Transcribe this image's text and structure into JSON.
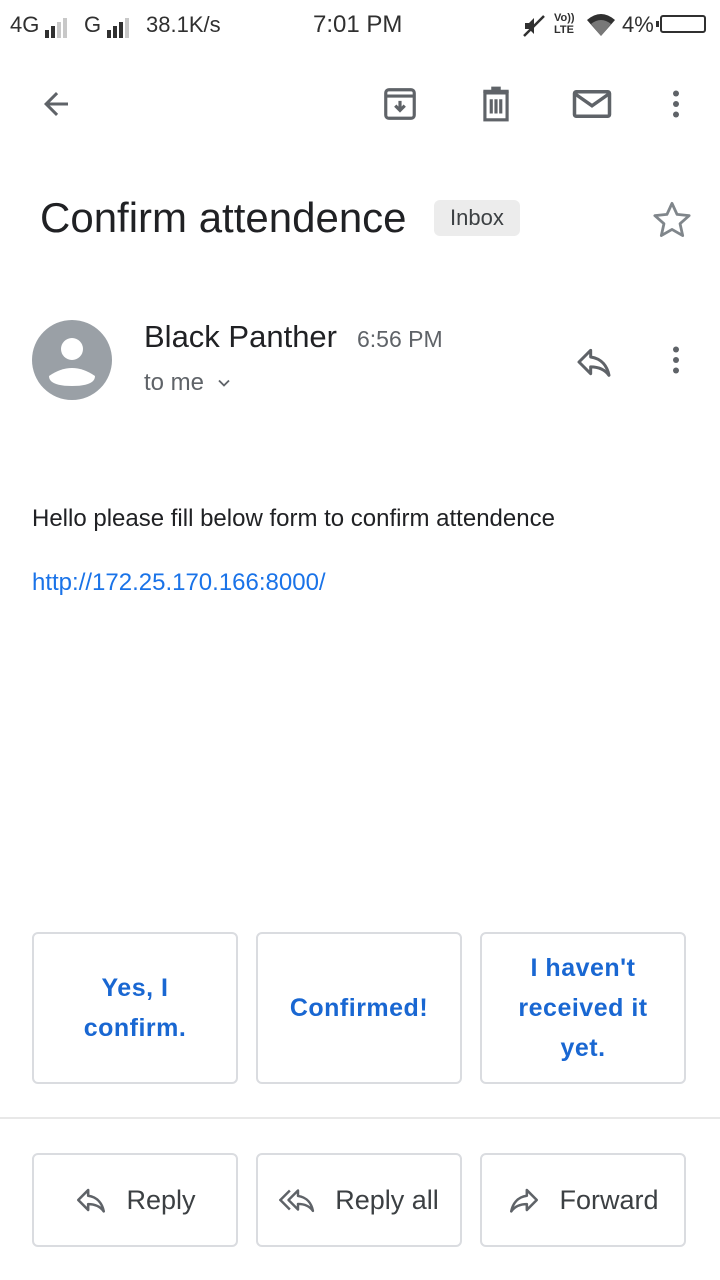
{
  "status_bar": {
    "network1": "4G",
    "network2": "G",
    "speed": "38.1K/s",
    "time": "7:01 PM",
    "volte": "Vo)) LTE",
    "battery": "4%"
  },
  "toolbar": {
    "back_icon": "arrow-left-icon",
    "archive_icon": "archive-icon",
    "delete_icon": "trash-icon",
    "mark_unread_icon": "mail-icon",
    "more_icon": "more-vert-icon"
  },
  "email": {
    "subject": "Confirm attendence",
    "label": "Inbox",
    "sender": "Black Panther",
    "time": "6:56 PM",
    "recipient": "to me",
    "body": "Hello please fill below form to confirm attendence",
    "link": "http://172.25.170.166:8000/"
  },
  "smart_replies": [
    "Yes, I confirm.",
    "Confirmed!",
    "I haven't received it yet."
  ],
  "actions": {
    "reply": "Reply",
    "reply_all": "Reply all",
    "forward": "Forward"
  },
  "colors": {
    "link": "#1a73e8",
    "smart_reply_text": "#1967d2",
    "icon": "#5f6368"
  }
}
